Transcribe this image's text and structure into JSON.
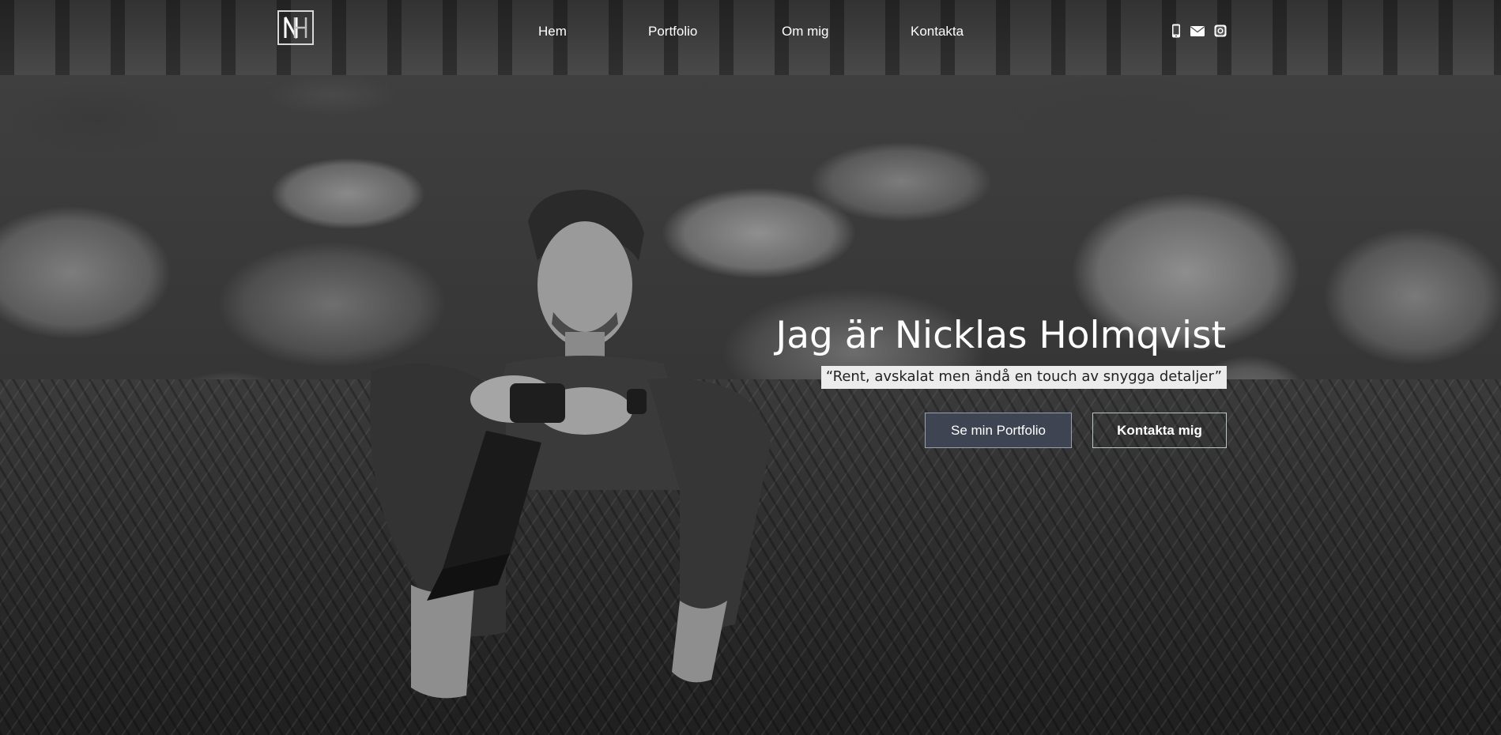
{
  "logo": {
    "text": "NH"
  },
  "nav": {
    "items": [
      {
        "label": "Hem"
      },
      {
        "label": "Portfolio"
      },
      {
        "label": "Om mig"
      },
      {
        "label": "Kontakta"
      }
    ]
  },
  "social": {
    "icons": [
      "phone-icon",
      "mail-icon",
      "instagram-icon"
    ]
  },
  "hero": {
    "title": "Jag är Nicklas Holmqvist",
    "tagline": "“Rent, avskalat men ändå en touch av snygga detaljer”",
    "buttons": {
      "portfolio_label": "Se min Portfolio",
      "contact_label": "Kontakta mig"
    }
  }
}
